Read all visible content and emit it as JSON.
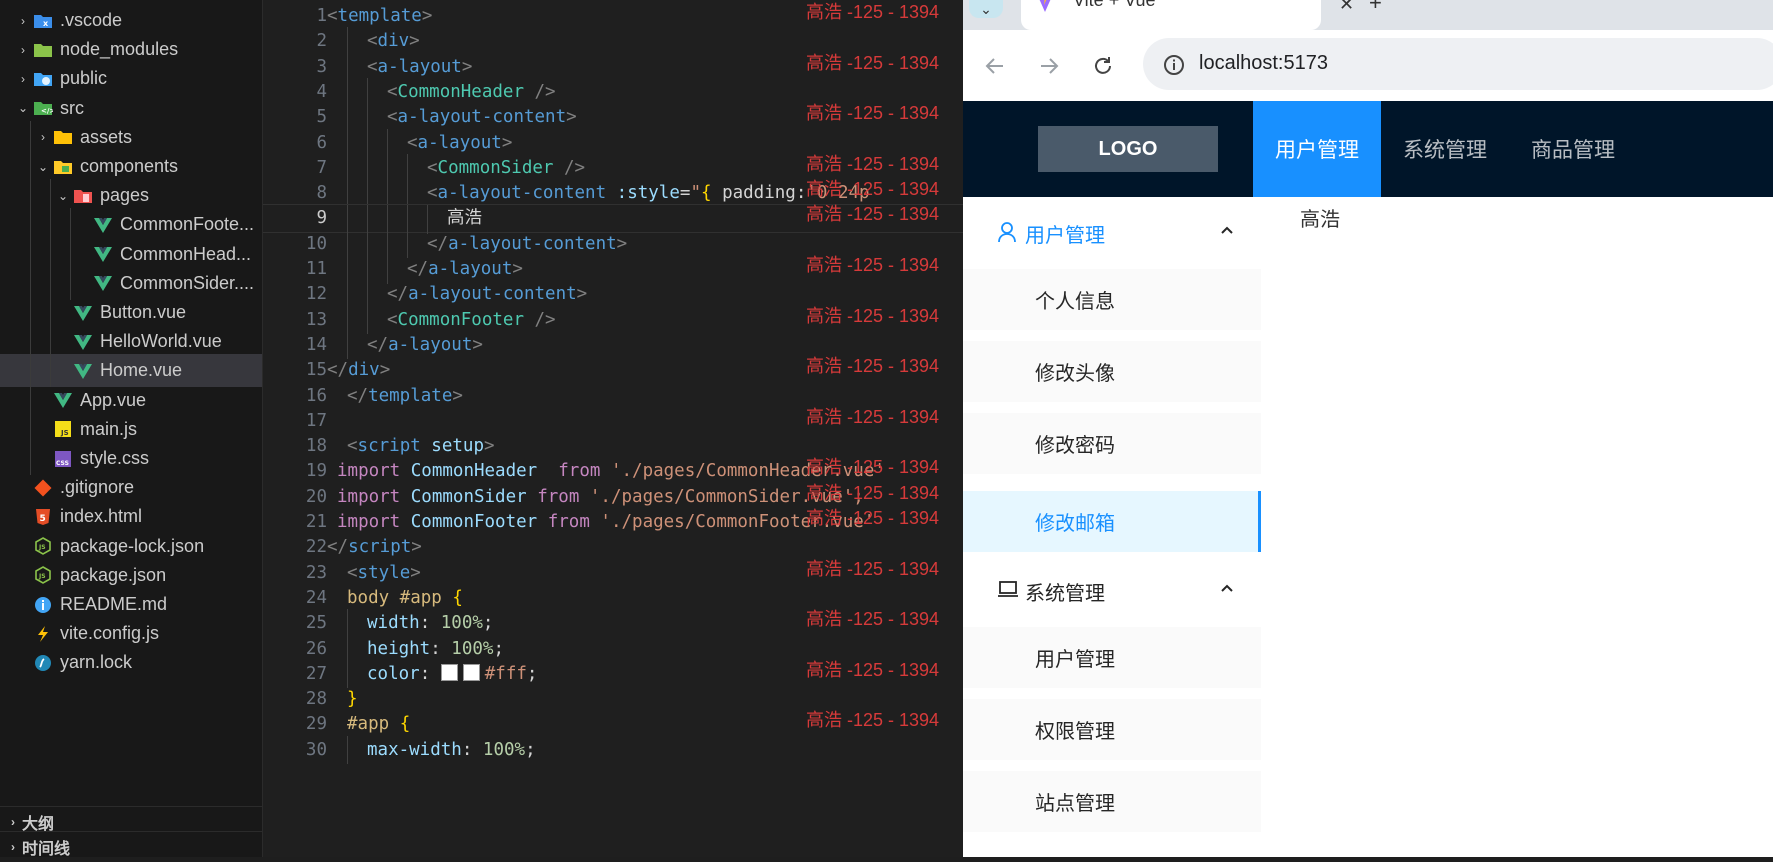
{
  "explorer": {
    "items": [
      {
        "label": ".vscode",
        "icon": "vscode-folder-icon",
        "chev": "›"
      },
      {
        "label": "node_modules",
        "icon": "node-folder-icon",
        "chev": "›"
      },
      {
        "label": "public",
        "icon": "public-folder-icon",
        "chev": "›"
      },
      {
        "label": "src",
        "icon": "src-folder-icon",
        "chev": "⌄"
      },
      {
        "label": "assets",
        "icon": "assets-folder-icon",
        "chev": "›"
      },
      {
        "label": "components",
        "icon": "components-folder-icon",
        "chev": "⌄"
      },
      {
        "label": "pages",
        "icon": "pages-folder-icon",
        "chev": "⌄"
      },
      {
        "label": "CommonFoote...",
        "icon": "vue-file-icon"
      },
      {
        "label": "CommonHead...",
        "icon": "vue-file-icon"
      },
      {
        "label": "CommonSider....",
        "icon": "vue-file-icon"
      },
      {
        "label": "Button.vue",
        "icon": "vue-file-icon"
      },
      {
        "label": "HelloWorld.vue",
        "icon": "vue-file-icon"
      },
      {
        "label": "Home.vue",
        "icon": "vue-file-icon"
      },
      {
        "label": "App.vue",
        "icon": "vue-file-icon"
      },
      {
        "label": "main.js",
        "icon": "js-file-icon"
      },
      {
        "label": "style.css",
        "icon": "css-file-icon"
      },
      {
        "label": ".gitignore",
        "icon": "git-file-icon"
      },
      {
        "label": "index.html",
        "icon": "html-file-icon"
      },
      {
        "label": "package-lock.json",
        "icon": "node-file-icon"
      },
      {
        "label": "package.json",
        "icon": "node-file-icon"
      },
      {
        "label": "README.md",
        "icon": "info-file-icon"
      },
      {
        "label": "vite.config.js",
        "icon": "vite-file-icon"
      },
      {
        "label": "yarn.lock",
        "icon": "yarn-file-icon"
      }
    ],
    "sections": {
      "outline": "大纲",
      "timeline": "时间线"
    }
  },
  "editor": {
    "line_numbers": [
      "1",
      "2",
      "3",
      "4",
      "5",
      "6",
      "7",
      "8",
      "9",
      "10",
      "11",
      "12",
      "13",
      "14",
      "15",
      "16",
      "17",
      "18",
      "19",
      "20",
      "21",
      "22",
      "23",
      "24",
      "25",
      "26",
      "27",
      "28",
      "29",
      "30"
    ],
    "watermark": "高浩 -125 - 1394",
    "lines": [
      [
        {
          "t": "<",
          "c": "p"
        },
        {
          "t": "template",
          "c": "t"
        },
        {
          "t": ">",
          "c": "p"
        }
      ],
      [
        {
          "t": "<",
          "c": "p"
        },
        {
          "t": "div",
          "c": "t"
        },
        {
          "t": ">",
          "c": "p"
        }
      ],
      [
        {
          "t": "<",
          "c": "p"
        },
        {
          "t": "a-layout",
          "c": "t"
        },
        {
          "t": ">",
          "c": "p"
        }
      ],
      [
        {
          "t": "<",
          "c": "p"
        },
        {
          "t": "CommonHeader",
          "c": "c"
        },
        {
          "t": " />",
          "c": "p"
        }
      ],
      [
        {
          "t": "<",
          "c": "p"
        },
        {
          "t": "a-layout-content",
          "c": "t"
        },
        {
          "t": ">",
          "c": "p"
        }
      ],
      [
        {
          "t": "<",
          "c": "p"
        },
        {
          "t": "a-layout",
          "c": "t"
        },
        {
          "t": ">",
          "c": "p"
        }
      ],
      [
        {
          "t": "<",
          "c": "p"
        },
        {
          "t": "CommonSider",
          "c": "c"
        },
        {
          "t": " />",
          "c": "p"
        }
      ],
      [
        {
          "t": "<",
          "c": "p"
        },
        {
          "t": "a-layout-content",
          "c": "t"
        },
        {
          "t": " :style",
          "c": "a"
        },
        {
          "t": "=",
          "c": "w"
        },
        {
          "t": "\"",
          "c": "s"
        },
        {
          "t": "{",
          "c": "y"
        },
        {
          "t": " padding",
          "c": "w"
        },
        {
          "t": ":",
          "c": "w"
        },
        {
          "t": "'0 24p",
          "c": "s"
        }
      ],
      [
        {
          "t": "高浩",
          "c": "w"
        }
      ],
      [
        {
          "t": "</",
          "c": "p"
        },
        {
          "t": "a-layout-content",
          "c": "t"
        },
        {
          "t": ">",
          "c": "p"
        }
      ],
      [
        {
          "t": "</",
          "c": "p"
        },
        {
          "t": "a-layout",
          "c": "t"
        },
        {
          "t": ">",
          "c": "p"
        }
      ],
      [
        {
          "t": "</",
          "c": "p"
        },
        {
          "t": "a-layout-content",
          "c": "t"
        },
        {
          "t": ">",
          "c": "p"
        }
      ],
      [
        {
          "t": "<",
          "c": "p"
        },
        {
          "t": "CommonFooter",
          "c": "c"
        },
        {
          "t": " />",
          "c": "p"
        }
      ],
      [
        {
          "t": "</",
          "c": "p"
        },
        {
          "t": "a-layout",
          "c": "t"
        },
        {
          "t": ">",
          "c": "p"
        }
      ],
      [
        {
          "t": "</",
          "c": "p"
        },
        {
          "t": "div",
          "c": "t"
        },
        {
          "t": ">",
          "c": "p"
        }
      ],
      [
        {
          "t": "</",
          "c": "p"
        },
        {
          "t": "template",
          "c": "t"
        },
        {
          "t": ">",
          "c": "p"
        }
      ],
      [],
      [
        {
          "t": "<",
          "c": "p"
        },
        {
          "t": "script",
          "c": "t"
        },
        {
          "t": " setup",
          "c": "a"
        },
        {
          "t": ">",
          "c": "p"
        }
      ],
      [
        {
          "t": "import ",
          "c": "k"
        },
        {
          "t": "CommonHeader",
          "c": "v"
        },
        {
          "t": "  from ",
          "c": "k"
        },
        {
          "t": "'./pages/CommonHeader.vue'",
          "c": "s"
        }
      ],
      [
        {
          "t": "import ",
          "c": "k"
        },
        {
          "t": "CommonSider",
          "c": "v"
        },
        {
          "t": " from ",
          "c": "k"
        },
        {
          "t": "'./pages/CommonSider.vue';",
          "c": "s"
        }
      ],
      [
        {
          "t": "import ",
          "c": "k"
        },
        {
          "t": "CommonFooter",
          "c": "v"
        },
        {
          "t": " from ",
          "c": "k"
        },
        {
          "t": "'./pages/CommonFooter.vue'",
          "c": "s"
        }
      ],
      [
        {
          "t": "</",
          "c": "p"
        },
        {
          "t": "script",
          "c": "t"
        },
        {
          "t": ">",
          "c": "p"
        }
      ],
      [
        {
          "t": "<",
          "c": "p"
        },
        {
          "t": "style",
          "c": "t"
        },
        {
          "t": ">",
          "c": "p"
        }
      ],
      [
        {
          "t": "body #app ",
          "c": "sel"
        },
        {
          "t": "{",
          "c": "y"
        }
      ],
      [
        {
          "t": "width",
          "c": "a"
        },
        {
          "t": ": ",
          "c": "w"
        },
        {
          "t": "100%",
          "c": "n"
        },
        {
          "t": ";",
          "c": "w"
        }
      ],
      [
        {
          "t": "height",
          "c": "a"
        },
        {
          "t": ": ",
          "c": "w"
        },
        {
          "t": "100%",
          "c": "n"
        },
        {
          "t": ";",
          "c": "w"
        }
      ],
      [
        {
          "t": "color",
          "c": "a"
        },
        {
          "t": ": ",
          "c": "w"
        },
        {
          "t": "■",
          "c": "sw"
        },
        {
          "t": "■",
          "c": "sw"
        },
        {
          "t": "#fff",
          "c": "s"
        },
        {
          "t": ";",
          "c": "w"
        }
      ],
      [
        {
          "t": "}",
          "c": "y"
        }
      ],
      [
        {
          "t": "#app ",
          "c": "sel"
        },
        {
          "t": "{",
          "c": "y"
        }
      ],
      [
        {
          "t": "max-width",
          "c": "a"
        },
        {
          "t": ": ",
          "c": "w"
        },
        {
          "t": "100%",
          "c": "n"
        },
        {
          "t": ";",
          "c": "w"
        }
      ]
    ]
  },
  "browser": {
    "tab_title": "Vite + Vue",
    "tab_close": "✕",
    "new_tab": "+",
    "url": "localhost:5173",
    "app": {
      "logo": "LOGO",
      "top_nav": [
        "用户管理",
        "系统管理",
        "商品管理"
      ],
      "sider": {
        "groups": [
          {
            "title": "用户管理",
            "items": [
              "个人信息",
              "修改头像",
              "修改密码",
              "修改邮箱"
            ]
          },
          {
            "title": "系统管理",
            "items": [
              "用户管理",
              "权限管理",
              "站点管理"
            ]
          }
        ]
      },
      "content": "高浩"
    }
  },
  "colors": {
    "accent": "#1890ff",
    "header_bg": "#001529",
    "watermark": "#d63a3a"
  }
}
